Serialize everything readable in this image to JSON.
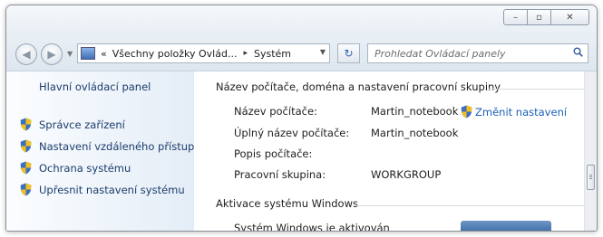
{
  "window": {
    "caption_buttons": [
      {
        "name": "minimize",
        "glyph": "–"
      },
      {
        "name": "maximize",
        "glyph": "▫"
      },
      {
        "name": "close",
        "glyph": "✕"
      }
    ]
  },
  "nav": {
    "back_glyph": "◀",
    "forward_glyph": "▶",
    "breadcrumb": {
      "prefix": "«",
      "items": [
        "Všechny položky Ovlád...",
        "Systém"
      ],
      "separator": "▸"
    },
    "refresh_glyph": "↻",
    "search_placeholder": "Prohledat Ovládací panely"
  },
  "sidebar": {
    "home_label": "Hlavní ovládací panel",
    "items": [
      {
        "label": "Správce zařízení",
        "icon": "uac-shield-icon"
      },
      {
        "label": "Nastavení vzdáleného přístupu",
        "icon": "uac-shield-icon"
      },
      {
        "label": "Ochrana systému",
        "icon": "uac-shield-icon"
      },
      {
        "label": "Upřesnit nastavení systému",
        "icon": "uac-shield-icon"
      }
    ]
  },
  "main": {
    "section1_title": "Název počítače, doména a nastavení pracovní skupiny",
    "rows": [
      {
        "label": "Název počítače:",
        "value": "Martin_notebook"
      },
      {
        "label": "Úplný název počítače:",
        "value": "Martin_notebook"
      },
      {
        "label": "Popis počítače:",
        "value": ""
      },
      {
        "label": "Pracovní skupina:",
        "value": "WORKGROUP"
      }
    ],
    "change_settings_link": "Změnit nastavení",
    "section2_title": "Aktivace systému Windows",
    "cut_row_text": "Systém Windows je aktivován"
  },
  "colors": {
    "link": "#1a5fb4",
    "sidebar_text": "#1b3c6b",
    "shield_blue": "#3b6fc1",
    "shield_yellow": "#f2c11e"
  }
}
